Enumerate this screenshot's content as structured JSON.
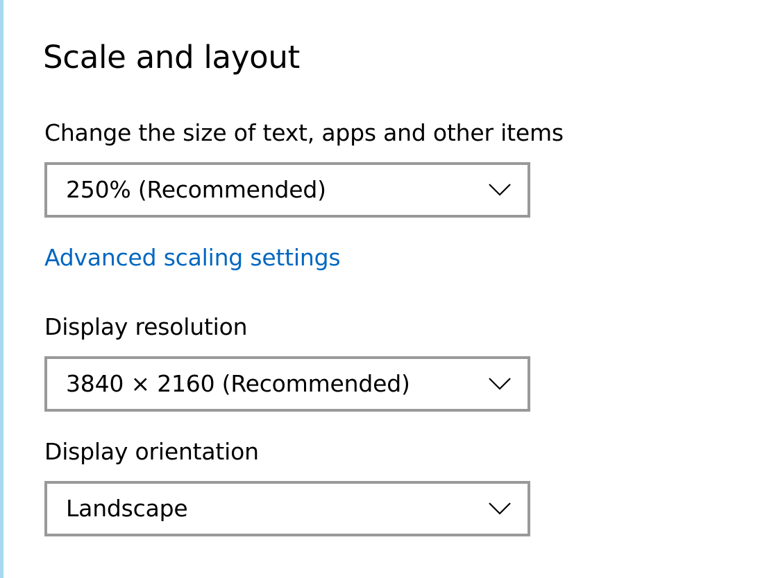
{
  "colors": {
    "link": "#0067c0",
    "border": "#999999",
    "left_accent": "#a7d8f0",
    "text": "#000000"
  },
  "section": {
    "title": "Scale and layout"
  },
  "scale": {
    "label": "Change the size of text, apps and other items",
    "value": "250% (Recommended)",
    "icon": "chevron-down-icon"
  },
  "advanced_link": {
    "label": "Advanced scaling settings"
  },
  "resolution": {
    "label": "Display resolution",
    "value": "3840 × 2160 (Recommended)",
    "icon": "chevron-down-icon"
  },
  "orientation": {
    "label": "Display orientation",
    "value": "Landscape",
    "icon": "chevron-down-icon"
  }
}
